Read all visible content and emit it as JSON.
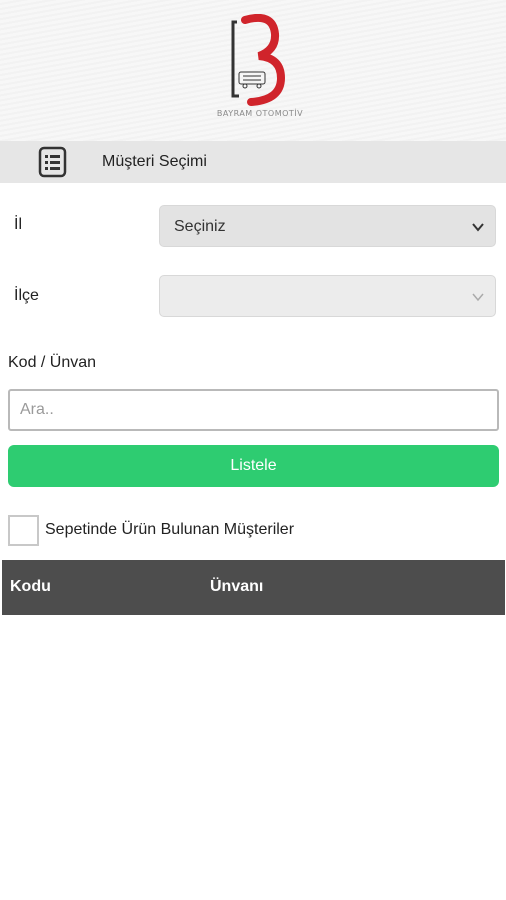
{
  "header": {
    "logo_caption": "BAYRAM OTOMOTİV",
    "colors": {
      "logo_red": "#d0242b",
      "logo_dark": "#333333"
    }
  },
  "title_bar": {
    "icon": "list-document-icon",
    "title": "Müşteri Seçimi"
  },
  "form": {
    "il": {
      "label": "İl",
      "selected": "Seçiniz"
    },
    "ilce": {
      "label": "İlçe",
      "selected": ""
    },
    "search": {
      "label": "Kod / Ünvan",
      "placeholder": "Ara..",
      "value": ""
    },
    "list_button": {
      "label": "Listele",
      "color": "#2ecc71"
    },
    "cart_filter": {
      "label": "Sepetinde Ürün Bulunan Müşteriler",
      "checked": false
    }
  },
  "table": {
    "columns": [
      "Kodu",
      "Ünvanı"
    ],
    "header_color": "#4d4d4d",
    "rows": []
  }
}
